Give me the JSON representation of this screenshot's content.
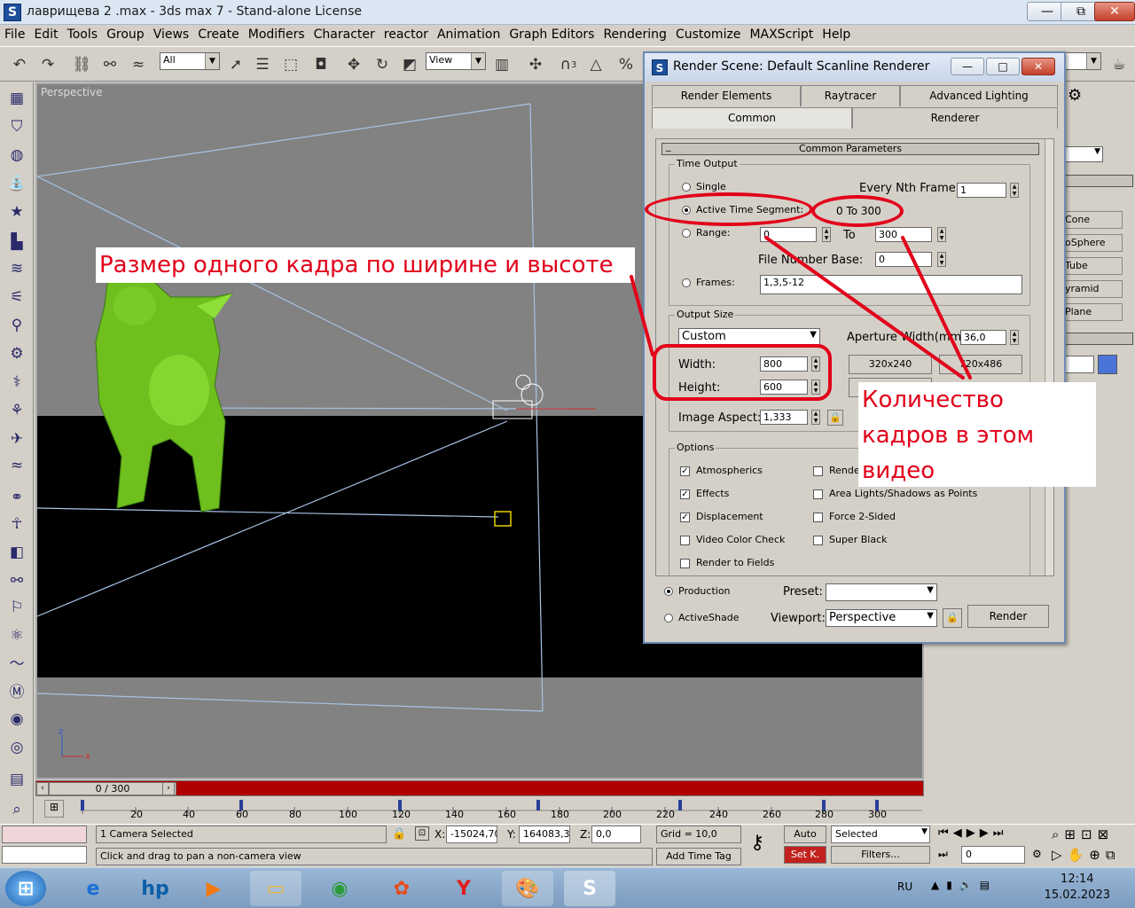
{
  "window": {
    "title": "лаврищева 2 .max - 3ds max 7   - Stand-alone License",
    "min": "—",
    "max": "⧉",
    "close": "✕"
  },
  "menu": [
    "File",
    "Edit",
    "Tools",
    "Group",
    "Views",
    "Create",
    "Modifiers",
    "Character",
    "reactor",
    "Animation",
    "Graph Editors",
    "Rendering",
    "Customize",
    "MAXScript",
    "Help"
  ],
  "toolbar": {
    "selection_filter": "All",
    "ref_coord": "View",
    "snap_num": "3"
  },
  "viewport": {
    "label": "Perspective"
  },
  "time_slider": {
    "value": "0 / 300"
  },
  "trackbar": {
    "ticks": [
      "20",
      "40",
      "60",
      "80",
      "100",
      "120",
      "140",
      "160",
      "180",
      "200",
      "220",
      "240",
      "260",
      "280",
      "300"
    ]
  },
  "status": {
    "selection": "1 Camera Selected",
    "prompt": "Click and drag to pan a non-camera view",
    "x_label": "X:",
    "x": "-15024,701",
    "y_label": "Y:",
    "y": "164083,35",
    "z_label": "Z:",
    "z": "0,0",
    "grid": "Grid = 10,0",
    "add_time_tag": "Add Time Tag",
    "auto": "Auto",
    "set_key": "Set K.",
    "key_filter": "Selected",
    "filters": "Filters...",
    "frame": "0"
  },
  "right_panel": {
    "items": [
      "Cone",
      "oSphere",
      "Tube",
      "yramid",
      "Plane"
    ]
  },
  "dialog": {
    "title": "Render Scene: Default Scanline Renderer",
    "tabs_row1": [
      "Render Elements",
      "Raytracer",
      "Advanced Lighting"
    ],
    "tabs_row2": [
      "Common",
      "Renderer"
    ],
    "rollout_title": "Common Parameters",
    "time_output": {
      "title": "Time Output",
      "single": "Single",
      "every_nth_label": "Every Nth Frame:",
      "every_nth": "1",
      "active_segment": "Active Time Segment:",
      "active_range": "0 To 300",
      "range": "Range:",
      "range_from": "0",
      "to_label": "To",
      "range_to": "300",
      "file_number_base_label": "File Number Base:",
      "file_number_base": "0",
      "frames_label": "Frames:",
      "frames": "1,3,5-12"
    },
    "output_size": {
      "title": "Output Size",
      "preset": "Custom",
      "aperture_label": "Aperture Width(mm):",
      "aperture": "36,0",
      "width_label": "Width:",
      "width": "800",
      "height_label": "Height:",
      "height": "600",
      "btn1": "320x240",
      "btn2": "720x486",
      "aspect_label": "Image Aspect:",
      "aspect": "1,333"
    },
    "options": {
      "title": "Options",
      "atmospherics": "Atmospherics",
      "render_hidden": "Render Hidden Geometry",
      "effects": "Effects",
      "area_lights": "Area Lights/Shadows as Points",
      "displacement": "Displacement",
      "force_2sided": "Force 2-Sided",
      "video_color_check": "Video Color Check",
      "super_black": "Super Black",
      "render_to_fields": "Render to Fields"
    },
    "production": "Production",
    "activeshade": "ActiveShade",
    "preset_label": "Preset:",
    "preset_value": "",
    "viewport_label": "Viewport:",
    "viewport_value": "Perspective",
    "render": "Render"
  },
  "annotations": {
    "frame_size": "Размер одного кадра по ширине и высоте",
    "frame_count": "Количество кадров в этом видео"
  },
  "taskbar": {
    "lang": "RU",
    "time": "12:14",
    "date": "15.02.2023"
  },
  "colors": {
    "annotation": "#e2001a",
    "viewport": "#828282",
    "time_slider": "#b00000"
  }
}
